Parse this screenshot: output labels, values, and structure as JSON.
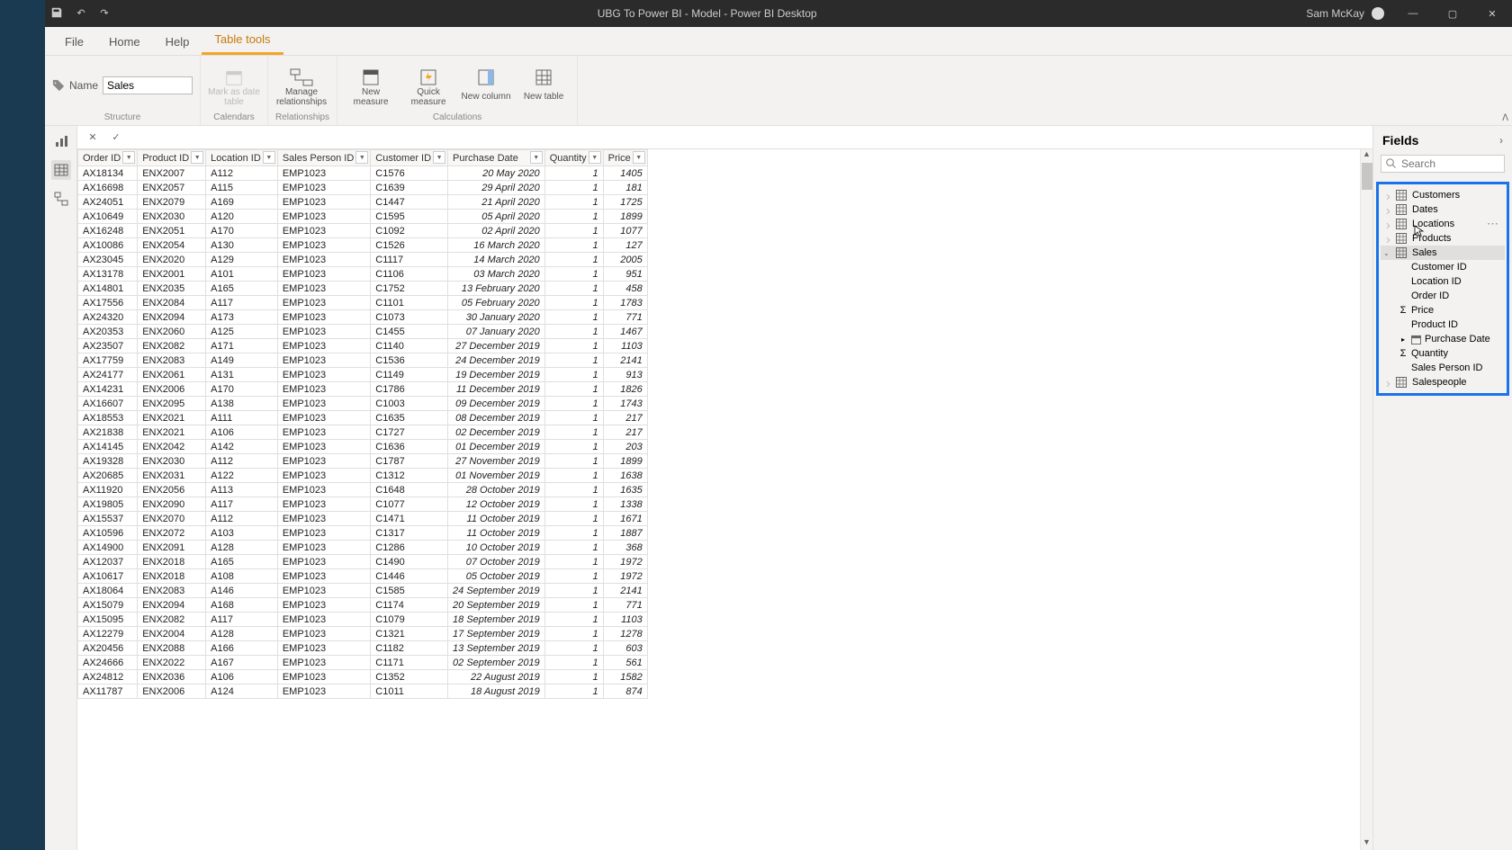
{
  "titlebar": {
    "title": "UBG To Power BI - Model - Power BI Desktop",
    "user": "Sam McKay"
  },
  "tabs": {
    "file": "File",
    "home": "Home",
    "help": "Help",
    "tabletools": "Table tools"
  },
  "ribbon": {
    "name_lbl": "Name",
    "name_val": "Sales",
    "mark_date": "Mark as date table",
    "manage_rel": "Manage relationships",
    "new_measure": "New measure",
    "quick_measure": "Quick measure",
    "new_column": "New column",
    "new_table": "New table",
    "grp_structure": "Structure",
    "grp_calendars": "Calendars",
    "grp_relationships": "Relationships",
    "grp_calculations": "Calculations"
  },
  "fields_pane": {
    "title": "Fields",
    "search_placeholder": "Search",
    "tables": [
      {
        "name": "Customers",
        "expanded": false
      },
      {
        "name": "Dates",
        "expanded": false
      },
      {
        "name": "Locations",
        "expanded": false
      },
      {
        "name": "Products",
        "expanded": false
      },
      {
        "name": "Sales",
        "expanded": true,
        "fields": [
          {
            "name": "Customer ID"
          },
          {
            "name": "Location ID"
          },
          {
            "name": "Order ID"
          },
          {
            "name": "Price",
            "sigma": true
          },
          {
            "name": "Product ID"
          },
          {
            "name": "Purchase Date",
            "hier": true
          },
          {
            "name": "Quantity",
            "sigma": true
          },
          {
            "name": "Sales Person ID"
          }
        ]
      },
      {
        "name": "Salespeople",
        "expanded": false
      }
    ]
  },
  "columns": [
    "Order ID",
    "Product ID",
    "Location ID",
    "Sales Person ID",
    "Customer ID",
    "Purchase Date",
    "Quantity",
    "Price"
  ],
  "rows": [
    [
      "AX18134",
      "ENX2007",
      "A112",
      "EMP1023",
      "C1576",
      "20 May 2020",
      "1",
      "1405"
    ],
    [
      "AX16698",
      "ENX2057",
      "A115",
      "EMP1023",
      "C1639",
      "29 April 2020",
      "1",
      "181"
    ],
    [
      "AX24051",
      "ENX2079",
      "A169",
      "EMP1023",
      "C1447",
      "21 April 2020",
      "1",
      "1725"
    ],
    [
      "AX10649",
      "ENX2030",
      "A120",
      "EMP1023",
      "C1595",
      "05 April 2020",
      "1",
      "1899"
    ],
    [
      "AX16248",
      "ENX2051",
      "A170",
      "EMP1023",
      "C1092",
      "02 April 2020",
      "1",
      "1077"
    ],
    [
      "AX10086",
      "ENX2054",
      "A130",
      "EMP1023",
      "C1526",
      "16 March 2020",
      "1",
      "127"
    ],
    [
      "AX23045",
      "ENX2020",
      "A129",
      "EMP1023",
      "C1117",
      "14 March 2020",
      "1",
      "2005"
    ],
    [
      "AX13178",
      "ENX2001",
      "A101",
      "EMP1023",
      "C1106",
      "03 March 2020",
      "1",
      "951"
    ],
    [
      "AX14801",
      "ENX2035",
      "A165",
      "EMP1023",
      "C1752",
      "13 February 2020",
      "1",
      "458"
    ],
    [
      "AX17556",
      "ENX2084",
      "A117",
      "EMP1023",
      "C1101",
      "05 February 2020",
      "1",
      "1783"
    ],
    [
      "AX24320",
      "ENX2094",
      "A173",
      "EMP1023",
      "C1073",
      "30 January 2020",
      "1",
      "771"
    ],
    [
      "AX20353",
      "ENX2060",
      "A125",
      "EMP1023",
      "C1455",
      "07 January 2020",
      "1",
      "1467"
    ],
    [
      "AX23507",
      "ENX2082",
      "A171",
      "EMP1023",
      "C1140",
      "27 December 2019",
      "1",
      "1103"
    ],
    [
      "AX17759",
      "ENX2083",
      "A149",
      "EMP1023",
      "C1536",
      "24 December 2019",
      "1",
      "2141"
    ],
    [
      "AX24177",
      "ENX2061",
      "A131",
      "EMP1023",
      "C1149",
      "19 December 2019",
      "1",
      "913"
    ],
    [
      "AX14231",
      "ENX2006",
      "A170",
      "EMP1023",
      "C1786",
      "11 December 2019",
      "1",
      "1826"
    ],
    [
      "AX16607",
      "ENX2095",
      "A138",
      "EMP1023",
      "C1003",
      "09 December 2019",
      "1",
      "1743"
    ],
    [
      "AX18553",
      "ENX2021",
      "A111",
      "EMP1023",
      "C1635",
      "08 December 2019",
      "1",
      "217"
    ],
    [
      "AX21838",
      "ENX2021",
      "A106",
      "EMP1023",
      "C1727",
      "02 December 2019",
      "1",
      "217"
    ],
    [
      "AX14145",
      "ENX2042",
      "A142",
      "EMP1023",
      "C1636",
      "01 December 2019",
      "1",
      "203"
    ],
    [
      "AX19328",
      "ENX2030",
      "A112",
      "EMP1023",
      "C1787",
      "27 November 2019",
      "1",
      "1899"
    ],
    [
      "AX20685",
      "ENX2031",
      "A122",
      "EMP1023",
      "C1312",
      "01 November 2019",
      "1",
      "1638"
    ],
    [
      "AX11920",
      "ENX2056",
      "A113",
      "EMP1023",
      "C1648",
      "28 October 2019",
      "1",
      "1635"
    ],
    [
      "AX19805",
      "ENX2090",
      "A117",
      "EMP1023",
      "C1077",
      "12 October 2019",
      "1",
      "1338"
    ],
    [
      "AX15537",
      "ENX2070",
      "A112",
      "EMP1023",
      "C1471",
      "11 October 2019",
      "1",
      "1671"
    ],
    [
      "AX10596",
      "ENX2072",
      "A103",
      "EMP1023",
      "C1317",
      "11 October 2019",
      "1",
      "1887"
    ],
    [
      "AX14900",
      "ENX2091",
      "A128",
      "EMP1023",
      "C1286",
      "10 October 2019",
      "1",
      "368"
    ],
    [
      "AX12037",
      "ENX2018",
      "A165",
      "EMP1023",
      "C1490",
      "07 October 2019",
      "1",
      "1972"
    ],
    [
      "AX10617",
      "ENX2018",
      "A108",
      "EMP1023",
      "C1446",
      "05 October 2019",
      "1",
      "1972"
    ],
    [
      "AX18064",
      "ENX2083",
      "A146",
      "EMP1023",
      "C1585",
      "24 September 2019",
      "1",
      "2141"
    ],
    [
      "AX15079",
      "ENX2094",
      "A168",
      "EMP1023",
      "C1174",
      "20 September 2019",
      "1",
      "771"
    ],
    [
      "AX15095",
      "ENX2082",
      "A117",
      "EMP1023",
      "C1079",
      "18 September 2019",
      "1",
      "1103"
    ],
    [
      "AX12279",
      "ENX2004",
      "A128",
      "EMP1023",
      "C1321",
      "17 September 2019",
      "1",
      "1278"
    ],
    [
      "AX20456",
      "ENX2088",
      "A166",
      "EMP1023",
      "C1182",
      "13 September 2019",
      "1",
      "603"
    ],
    [
      "AX24666",
      "ENX2022",
      "A167",
      "EMP1023",
      "C1171",
      "02 September 2019",
      "1",
      "561"
    ],
    [
      "AX24812",
      "ENX2036",
      "A106",
      "EMP1023",
      "C1352",
      "22 August 2019",
      "1",
      "1582"
    ],
    [
      "AX11787",
      "ENX2006",
      "A124",
      "EMP1023",
      "C1011",
      "18 August 2019",
      "1",
      "874"
    ]
  ]
}
